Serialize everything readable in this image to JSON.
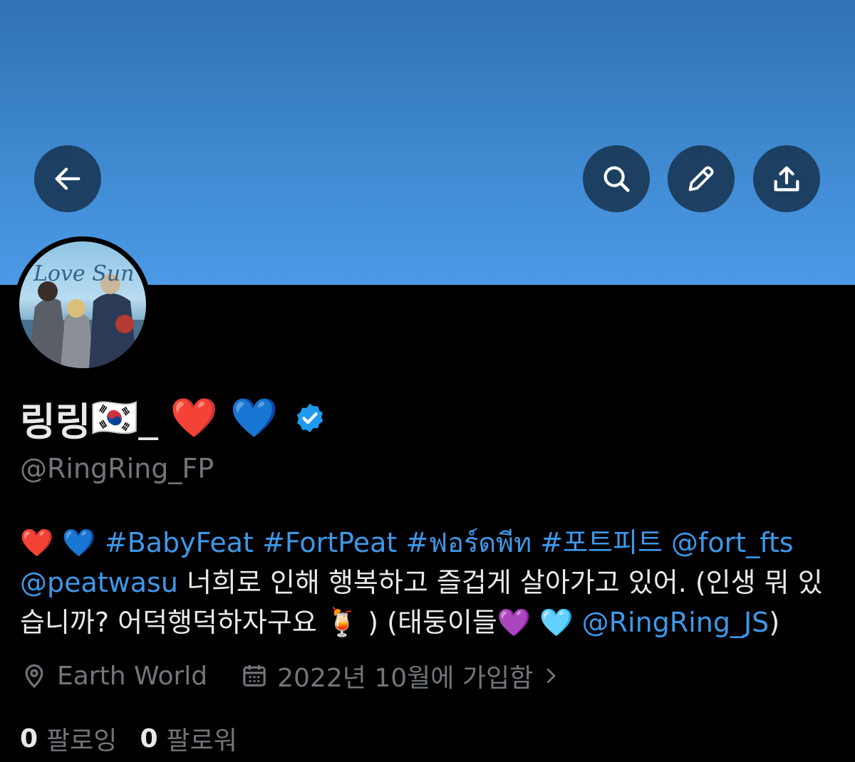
{
  "profile": {
    "display_name": "링링",
    "name_emoji": "🇰🇷_ ❤️ 💙",
    "handle": "@RingRing_FP",
    "verified_icon": "verified-badge-icon"
  },
  "bio": {
    "line1": {
      "emoji": "❤️ 💙",
      "tags": [
        "#BabyFeat",
        "#FortPeat",
        "#ฟอร์ดพีท",
        "#포트피트"
      ],
      "mention": "@fort_fts"
    },
    "line2": {
      "mention": "@peatwasu",
      "text": " 너희로 인해 행복하고 즐겁게 살아가고 있어. (인생 뭐 있"
    },
    "line3": {
      "text": "습니까? 어덕행덕하자구요 🍹 ) (태둥이들💜 🩵 ",
      "mention": "@RingRing_JS",
      "tail": ")"
    }
  },
  "meta": {
    "location": "Earth World",
    "joined": "2022년 10월에 가입함"
  },
  "stats": {
    "following_count": "0",
    "following_label": "팔로잉",
    "followers_count": "0",
    "followers_label": "팔로워"
  },
  "colors": {
    "banner_top": "#2f72b3",
    "banner_bottom": "#4b9ae6",
    "link": "#3e98e8",
    "muted": "#71767b",
    "verified": "#1d9bf0"
  }
}
